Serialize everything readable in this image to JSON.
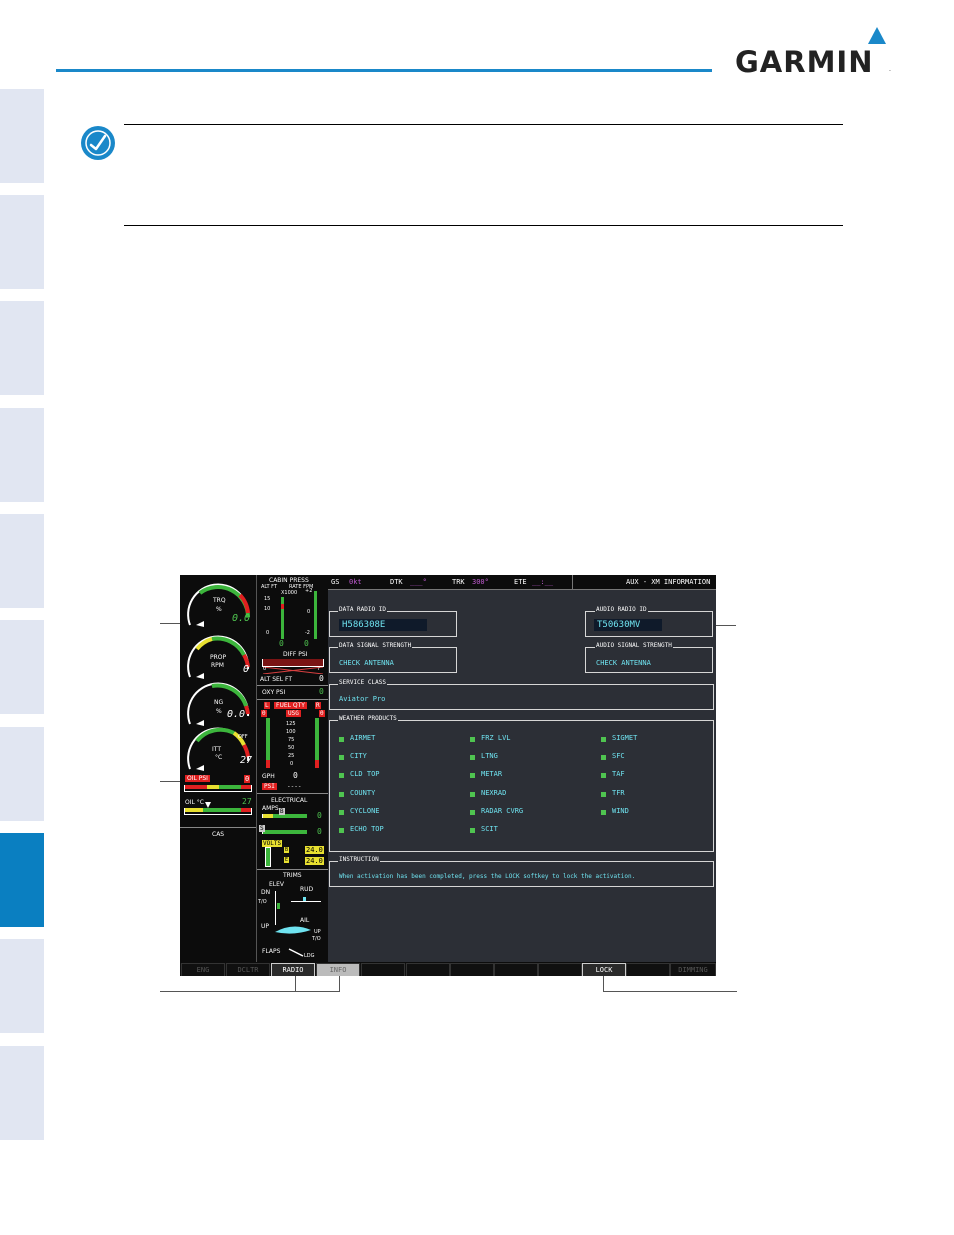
{
  "brand": {
    "name": "GARMIN",
    "reg": "."
  },
  "mfd": {
    "topbar": {
      "gs_label": "GS",
      "gs_value": "0kt",
      "dtk_label": "DTK",
      "dtk_value": "___°",
      "trk_label": "TRK",
      "trk_value": "300°",
      "ete_label": "ETE",
      "ete_value": "__:__",
      "page_title": "AUX - XM INFORMATION"
    },
    "data_radio_id": {
      "label": "DATA RADIO ID",
      "value": "H586308E"
    },
    "audio_radio_id": {
      "label": "AUDIO RADIO ID",
      "value": "T50630MV"
    },
    "data_signal": {
      "label": "DATA SIGNAL STRENGTH",
      "value": "CHECK ANTENNA"
    },
    "audio_signal": {
      "label": "AUDIO SIGNAL STRENGTH",
      "value": "CHECK ANTENNA"
    },
    "service_class": {
      "label": "SERVICE CLASS",
      "value": "Aviator Pro"
    },
    "weather_products": {
      "label": "WEATHER PRODUCTS",
      "col1": [
        "AIRMET",
        "CITY",
        "CLD TOP",
        "COUNTY",
        "CYCLONE",
        "ECHO TOP"
      ],
      "col2": [
        "FRZ LVL",
        "LTNG",
        "METAR",
        "NEXRAD",
        "RADAR CVRG",
        "SCIT"
      ],
      "col3": [
        "SIGMET",
        "SFC",
        "TAF",
        "TFR",
        "WIND"
      ]
    },
    "instruction": {
      "label": "INSTRUCTION",
      "text": "When activation has been completed, press the LOCK softkey to lock the activation."
    }
  },
  "eis": {
    "trq": {
      "label": "TRQ",
      "unit": "%",
      "value": "0.0"
    },
    "prop": {
      "label": "PROP",
      "unit": "RPM",
      "value": "0"
    },
    "ng": {
      "label": "NG",
      "unit": "%",
      "value": "0.0"
    },
    "itt": {
      "label": "ITT",
      "unit": "°C",
      "value": "27",
      "off": "OFF"
    },
    "oil_psi": {
      "label": "OIL PSI",
      "value": "0"
    },
    "oil_c": {
      "label": "OIL °C",
      "value": "27"
    },
    "cas": "CAS",
    "cabin": {
      "title": "CABIN PRESS",
      "alt_ft": "ALT FT",
      "rate_fpm": "RATE FPM",
      "x1000": "X1000",
      "alt_ticks": [
        "15",
        "10",
        "0"
      ],
      "rate_ticks": [
        "+2",
        "0",
        "-2"
      ],
      "alt_value": "0",
      "rate_value": "0"
    },
    "diff_psi": {
      "label": "DIFF PSI",
      "min": "0",
      "max": "7"
    },
    "alt_sel": {
      "label": "ALT SEL FT",
      "value": "0"
    },
    "oxy": {
      "label": "OXY PSI",
      "value": "0"
    },
    "fuel": {
      "l": "L",
      "title": "FUEL QTY",
      "r": "R",
      "unit": "USG",
      "ticks": [
        "125",
        "100",
        "75",
        "50",
        "25",
        "0"
      ],
      "left": "0",
      "right": "0"
    },
    "gph": {
      "label": "GPH",
      "value": "0"
    },
    "psi": {
      "label": "PSI",
      "value": "----"
    },
    "electrical": {
      "title": "ELECTRICAL",
      "amps": "AMPS",
      "amps_marker": "B",
      "amps_marker2": "S",
      "amps_value1": "0",
      "amps_value2": "0",
      "volts": "VOLTS",
      "volts_b": "B",
      "volts_e": "E",
      "volt1": "24.0",
      "volt2": "24.0"
    },
    "trims": {
      "title": "TRIMS",
      "elev": "ELEV",
      "dn": "DN",
      "to": "T/O",
      "up": "UP",
      "rud": "RUD",
      "ail": "AIL",
      "up2": "UP",
      "to2": "T/O",
      "flaps": "FLAPS",
      "ldg": "LDG"
    }
  },
  "softkeys": [
    "ENG",
    "DCLTR",
    "RADIO",
    "INFO",
    "",
    "",
    "",
    "",
    "",
    "LOCK",
    "",
    "DIMMING"
  ],
  "colors": {
    "accent_blue": "#0a7fc1",
    "tab_light": "#e1e6f2",
    "mfd_cyan": "#6fe3f0",
    "mfd_green": "#4fc450",
    "mfd_magenta": "#c05bd0"
  }
}
